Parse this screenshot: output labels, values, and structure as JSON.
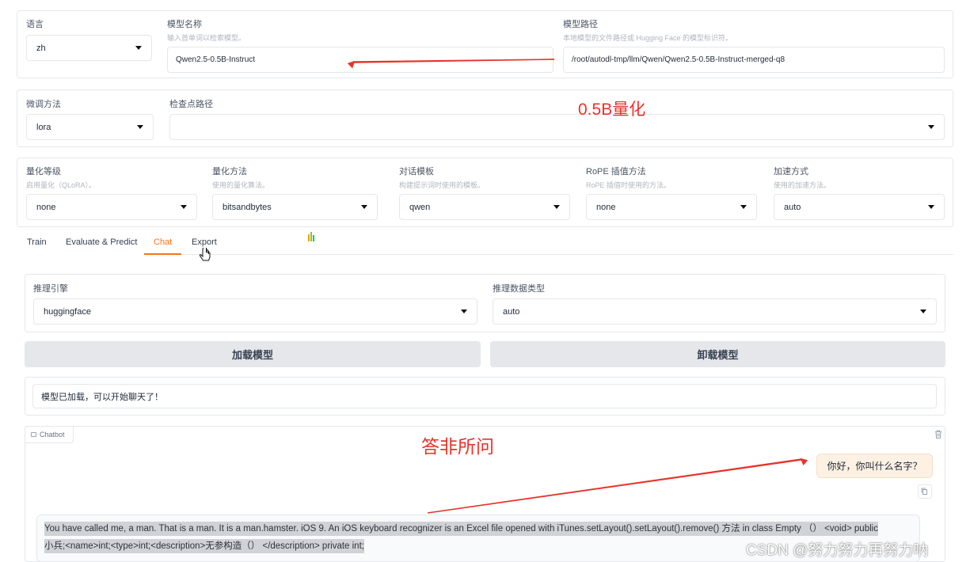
{
  "model_row": {
    "lang": {
      "label": "语言",
      "value": "zh"
    },
    "model_name": {
      "label": "模型名称",
      "hint": "输入首单词以检索模型。",
      "value": "Qwen2.5-0.5B-Instruct"
    },
    "model_path": {
      "label": "模型路径",
      "hint": "本地模型的文件路径或 Hugging Face 的模型标识符。",
      "value": "/root/autodl-tmp/llm/Qwen/Qwen2.5-0.5B-Instruct-merged-q8"
    }
  },
  "finetune_row": {
    "method": {
      "label": "微调方法",
      "value": "lora"
    },
    "checkpoint": {
      "label": "检查点路径",
      "value": ""
    }
  },
  "advanced_row": [
    {
      "label": "量化等级",
      "hint": "启用量化（QLoRA）。",
      "value": "none"
    },
    {
      "label": "量化方法",
      "hint": "使用的量化算法。",
      "value": "bitsandbytes"
    },
    {
      "label": "对话模板",
      "hint": "构建提示词时使用的模板。",
      "value": "qwen"
    },
    {
      "label": "RoPE 插值方法",
      "hint": "RoPE 插值时使用的方法。",
      "value": "none"
    },
    {
      "label": "加速方式",
      "hint": "使用的加速方法。",
      "value": "auto"
    }
  ],
  "tabs": [
    "Train",
    "Evaluate & Predict",
    "Chat",
    "Export"
  ],
  "active_tab": "Chat",
  "chat": {
    "engine": {
      "label": "推理引擎",
      "value": "huggingface"
    },
    "dtype": {
      "label": "推理数据类型",
      "value": "auto"
    },
    "load_button": "加载模型",
    "unload_button": "卸载模型",
    "status": "模型已加载，可以开始聊天了！",
    "chatbot_label": "Chatbot",
    "user_message": "你好，你叫什么名字？",
    "bot_message_line1": "You have called me, a man. That is a man. It is a man.hamster. iOS 9. An iOS keyboard recognizer is an Excel file opened with iTunes.setLayout().setLayout().remove() 方法 in class Empty （） <void> public",
    "bot_message_line2": "小兵;<name>int;<type>int;<description>无参构造（） </description> private int;"
  },
  "annotations": {
    "quantize_note": "0.5B量化",
    "irrelevant_note": "答非所问",
    "color": "#e8332b"
  },
  "watermark": "CSDN @努力努力再努力呐"
}
